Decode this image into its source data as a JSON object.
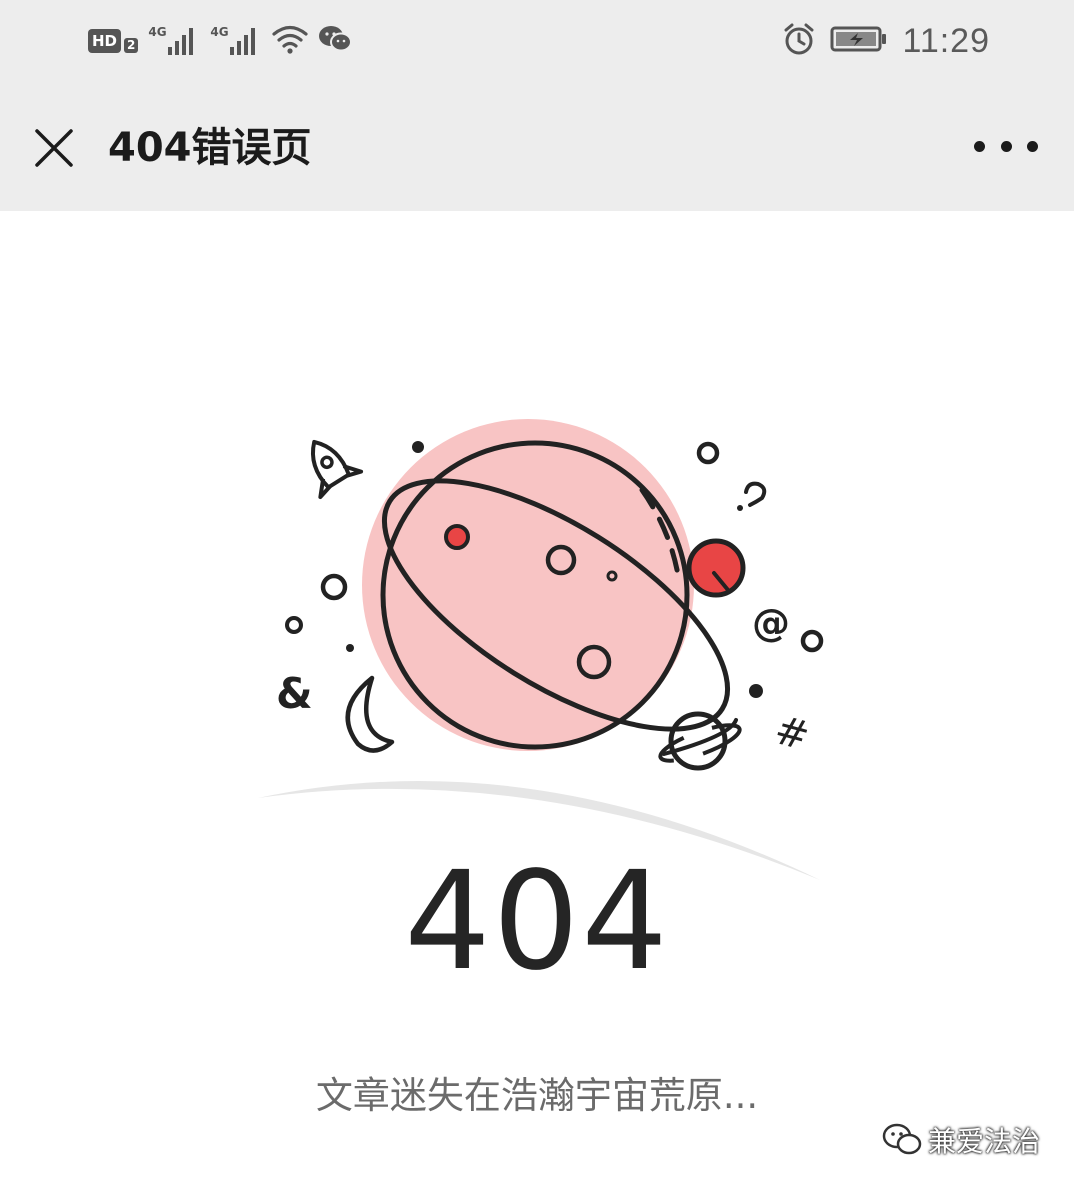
{
  "status_bar": {
    "hd_label": "HD",
    "hd_sub": "2",
    "signal1_label": "4G",
    "signal2_label": "4G",
    "time": "11:29"
  },
  "nav": {
    "title": "404错误页",
    "close_icon": "close-icon",
    "more_icon": "more-dots-icon"
  },
  "content": {
    "error_code": "404",
    "error_message": "文章迷失在浩瀚宇宙荒原...",
    "colors": {
      "planet_fill": "#f8c4c4",
      "accent_red": "#e84545",
      "stroke": "#222222"
    }
  },
  "watermark": {
    "text": "兼爱法治"
  }
}
